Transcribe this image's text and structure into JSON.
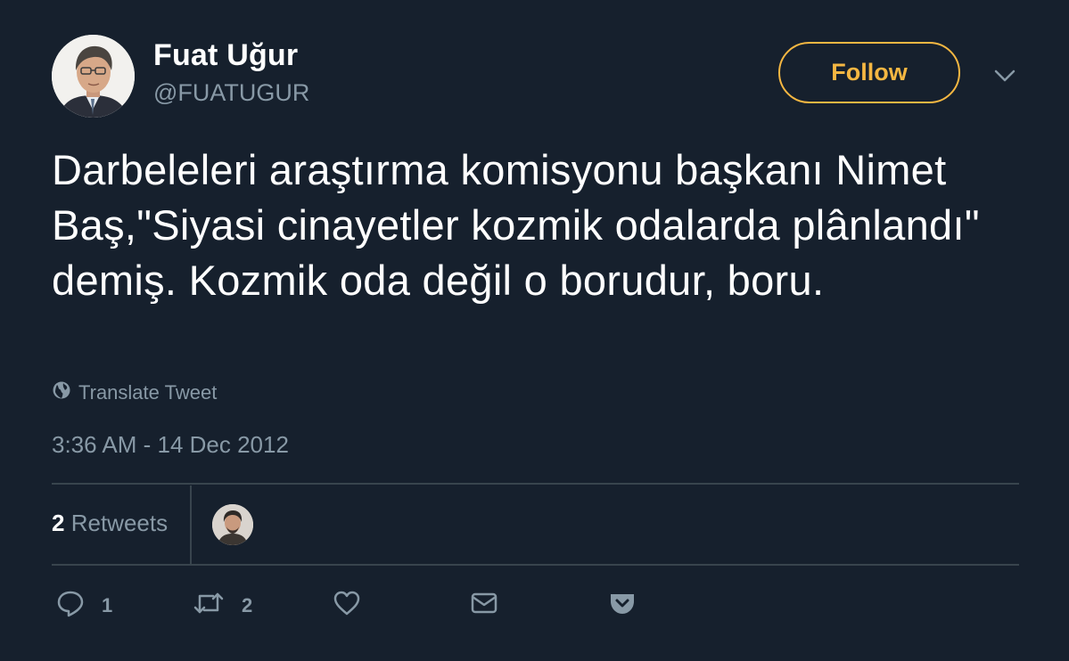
{
  "tweet": {
    "author_name": "Fuat Uğur",
    "author_handle": "@FUATUGUR",
    "follow_label": "Follow",
    "text": "Darbeleleri araştırma komisyonu başkanı Nimet Baş,\"Siyasi cinayetler kozmik odalarda plânlandı\" demiş. Kozmik oda değil o borudur, boru.",
    "translate_label": "Translate Tweet",
    "timestamp": "3:36 AM - 14 Dec 2012",
    "retweet_count": "2",
    "retweets_label": "Retweets"
  },
  "actions": {
    "reply_count": "1",
    "retweet_count": "2"
  },
  "icons": {
    "globe": "globe-icon",
    "chevron": "chevron-down-icon",
    "reply": "reply-icon",
    "retweet": "retweet-icon",
    "like": "heart-icon",
    "message": "envelope-icon",
    "pocket": "pocket-icon"
  },
  "colors": {
    "background": "#16202d",
    "accent": "#f5b742",
    "muted": "#8899a6",
    "divider": "#38444d"
  }
}
